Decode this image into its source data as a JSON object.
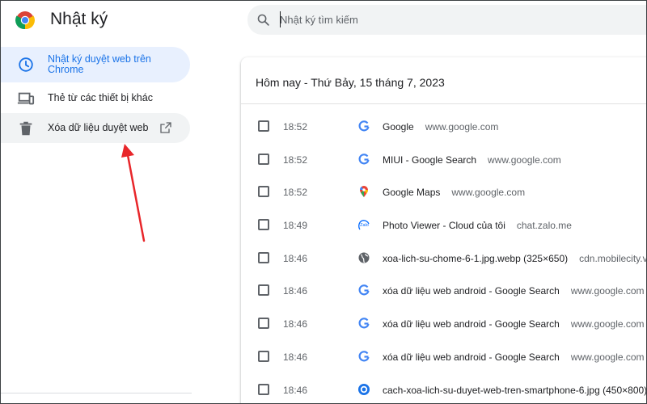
{
  "header": {
    "title": "Nhật ký",
    "search_placeholder": "Nhật ký tìm kiếm"
  },
  "sidebar": {
    "items": [
      {
        "label": "Nhật ký duyệt web trên Chrome",
        "icon": "clock-icon",
        "active": true
      },
      {
        "label": "Thẻ từ các thiết bị khác",
        "icon": "devices-icon"
      },
      {
        "label": "Xóa dữ liệu duyệt web",
        "icon": "trash-icon",
        "trailing_icon": "open-in-new-icon"
      }
    ]
  },
  "history": {
    "date_heading": "Hôm nay - Thứ Bảy, 15 tháng 7, 2023",
    "entries": [
      {
        "time": "18:52",
        "title": "Google",
        "domain": "www.google.com",
        "favicon": "google-icon"
      },
      {
        "time": "18:52",
        "title": "MIUI - Google Search",
        "domain": "www.google.com",
        "favicon": "google-icon"
      },
      {
        "time": "18:52",
        "title": "Google Maps",
        "domain": "www.google.com",
        "favicon": "maps-icon"
      },
      {
        "time": "18:49",
        "title": "Photo Viewer - Cloud của tôi",
        "domain": "chat.zalo.me",
        "favicon": "zalo-icon"
      },
      {
        "time": "18:46",
        "title": "xoa-lich-su-chome-6-1.jpg.webp (325×650)",
        "domain": "cdn.mobilecity.vn",
        "favicon": "globe-icon"
      },
      {
        "time": "18:46",
        "title": "xóa dữ liệu web android - Google Search",
        "domain": "www.google.com",
        "favicon": "google-icon"
      },
      {
        "time": "18:46",
        "title": "xóa dữ liệu web android - Google Search",
        "domain": "www.google.com",
        "favicon": "google-icon"
      },
      {
        "time": "18:46",
        "title": "xóa dữ liệu web android - Google Search",
        "domain": "www.google.com",
        "favicon": "google-icon"
      },
      {
        "time": "18:46",
        "title": "cach-xoa-lich-su-duyet-web-tren-smartphone-6.jpg (450×800)",
        "domain": "",
        "favicon": "site-icon"
      }
    ]
  },
  "colors": {
    "accent": "#1a73e8",
    "active_bg": "#e8f0fe",
    "annotation_arrow": "#e8262a"
  }
}
